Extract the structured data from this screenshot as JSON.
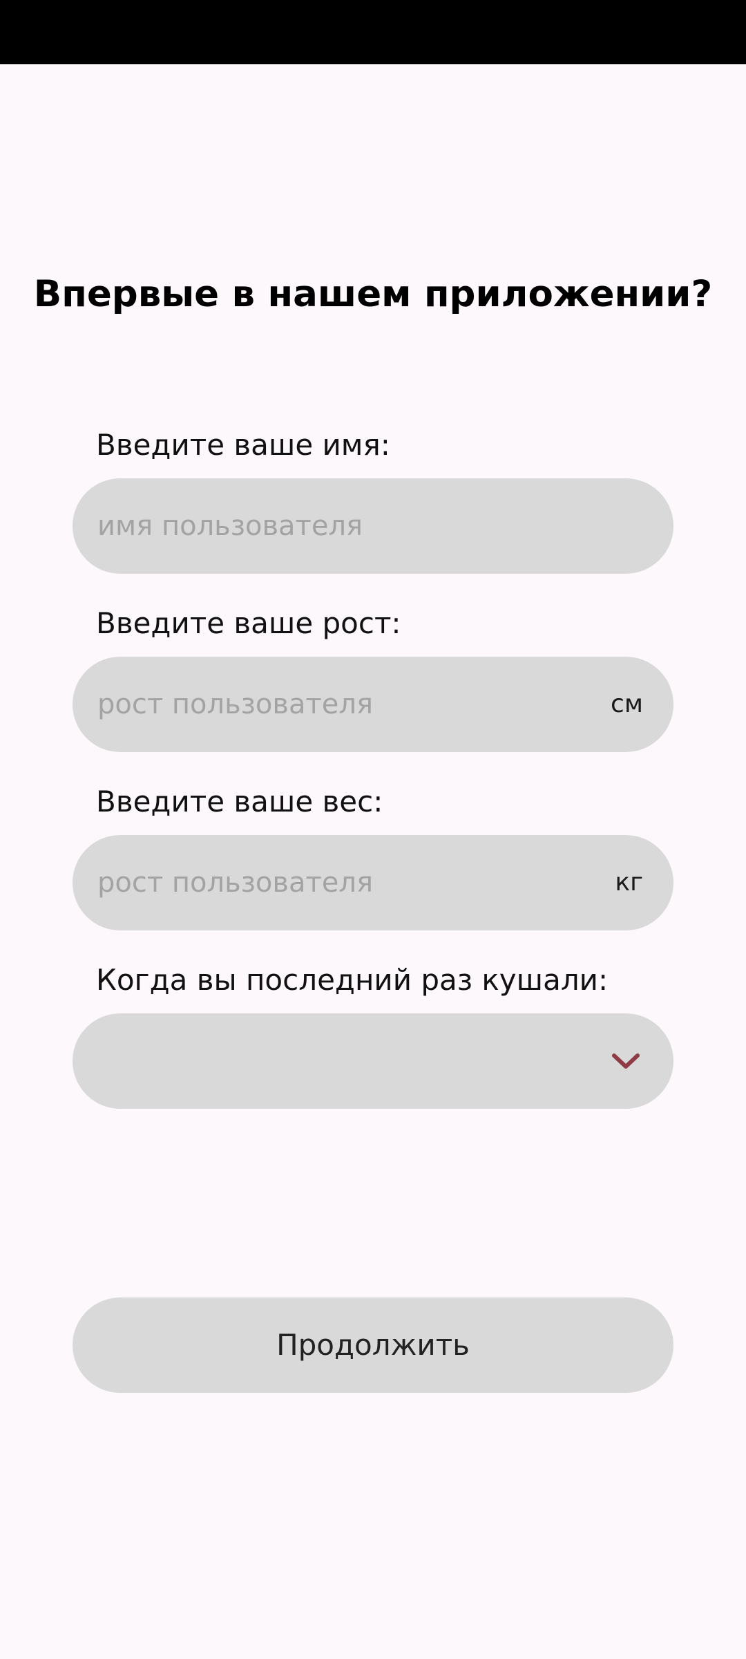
{
  "title": "Впервые в нашем приложении?",
  "fields": [
    {
      "label": "Введите ваше имя:",
      "value": "",
      "placeholder": "имя пользователя",
      "unit": ""
    },
    {
      "label": "Введите ваше рост:",
      "value": "",
      "placeholder": "рост пользователя",
      "unit": "см"
    },
    {
      "label": "Введите ваше вес:",
      "value": "",
      "placeholder": "рост пользователя",
      "unit": "кг"
    }
  ],
  "meal": {
    "label": "Когда вы последний раз кушали:",
    "selected": "",
    "icon": "chevron-down-icon"
  },
  "continue_label": "Продолжить",
  "colors": {
    "background": "#fdf8fb",
    "field": "#d9d9d9",
    "placeholder": "#a3a3a3",
    "accent": "#8e3b46",
    "status_bar": "#000000"
  }
}
